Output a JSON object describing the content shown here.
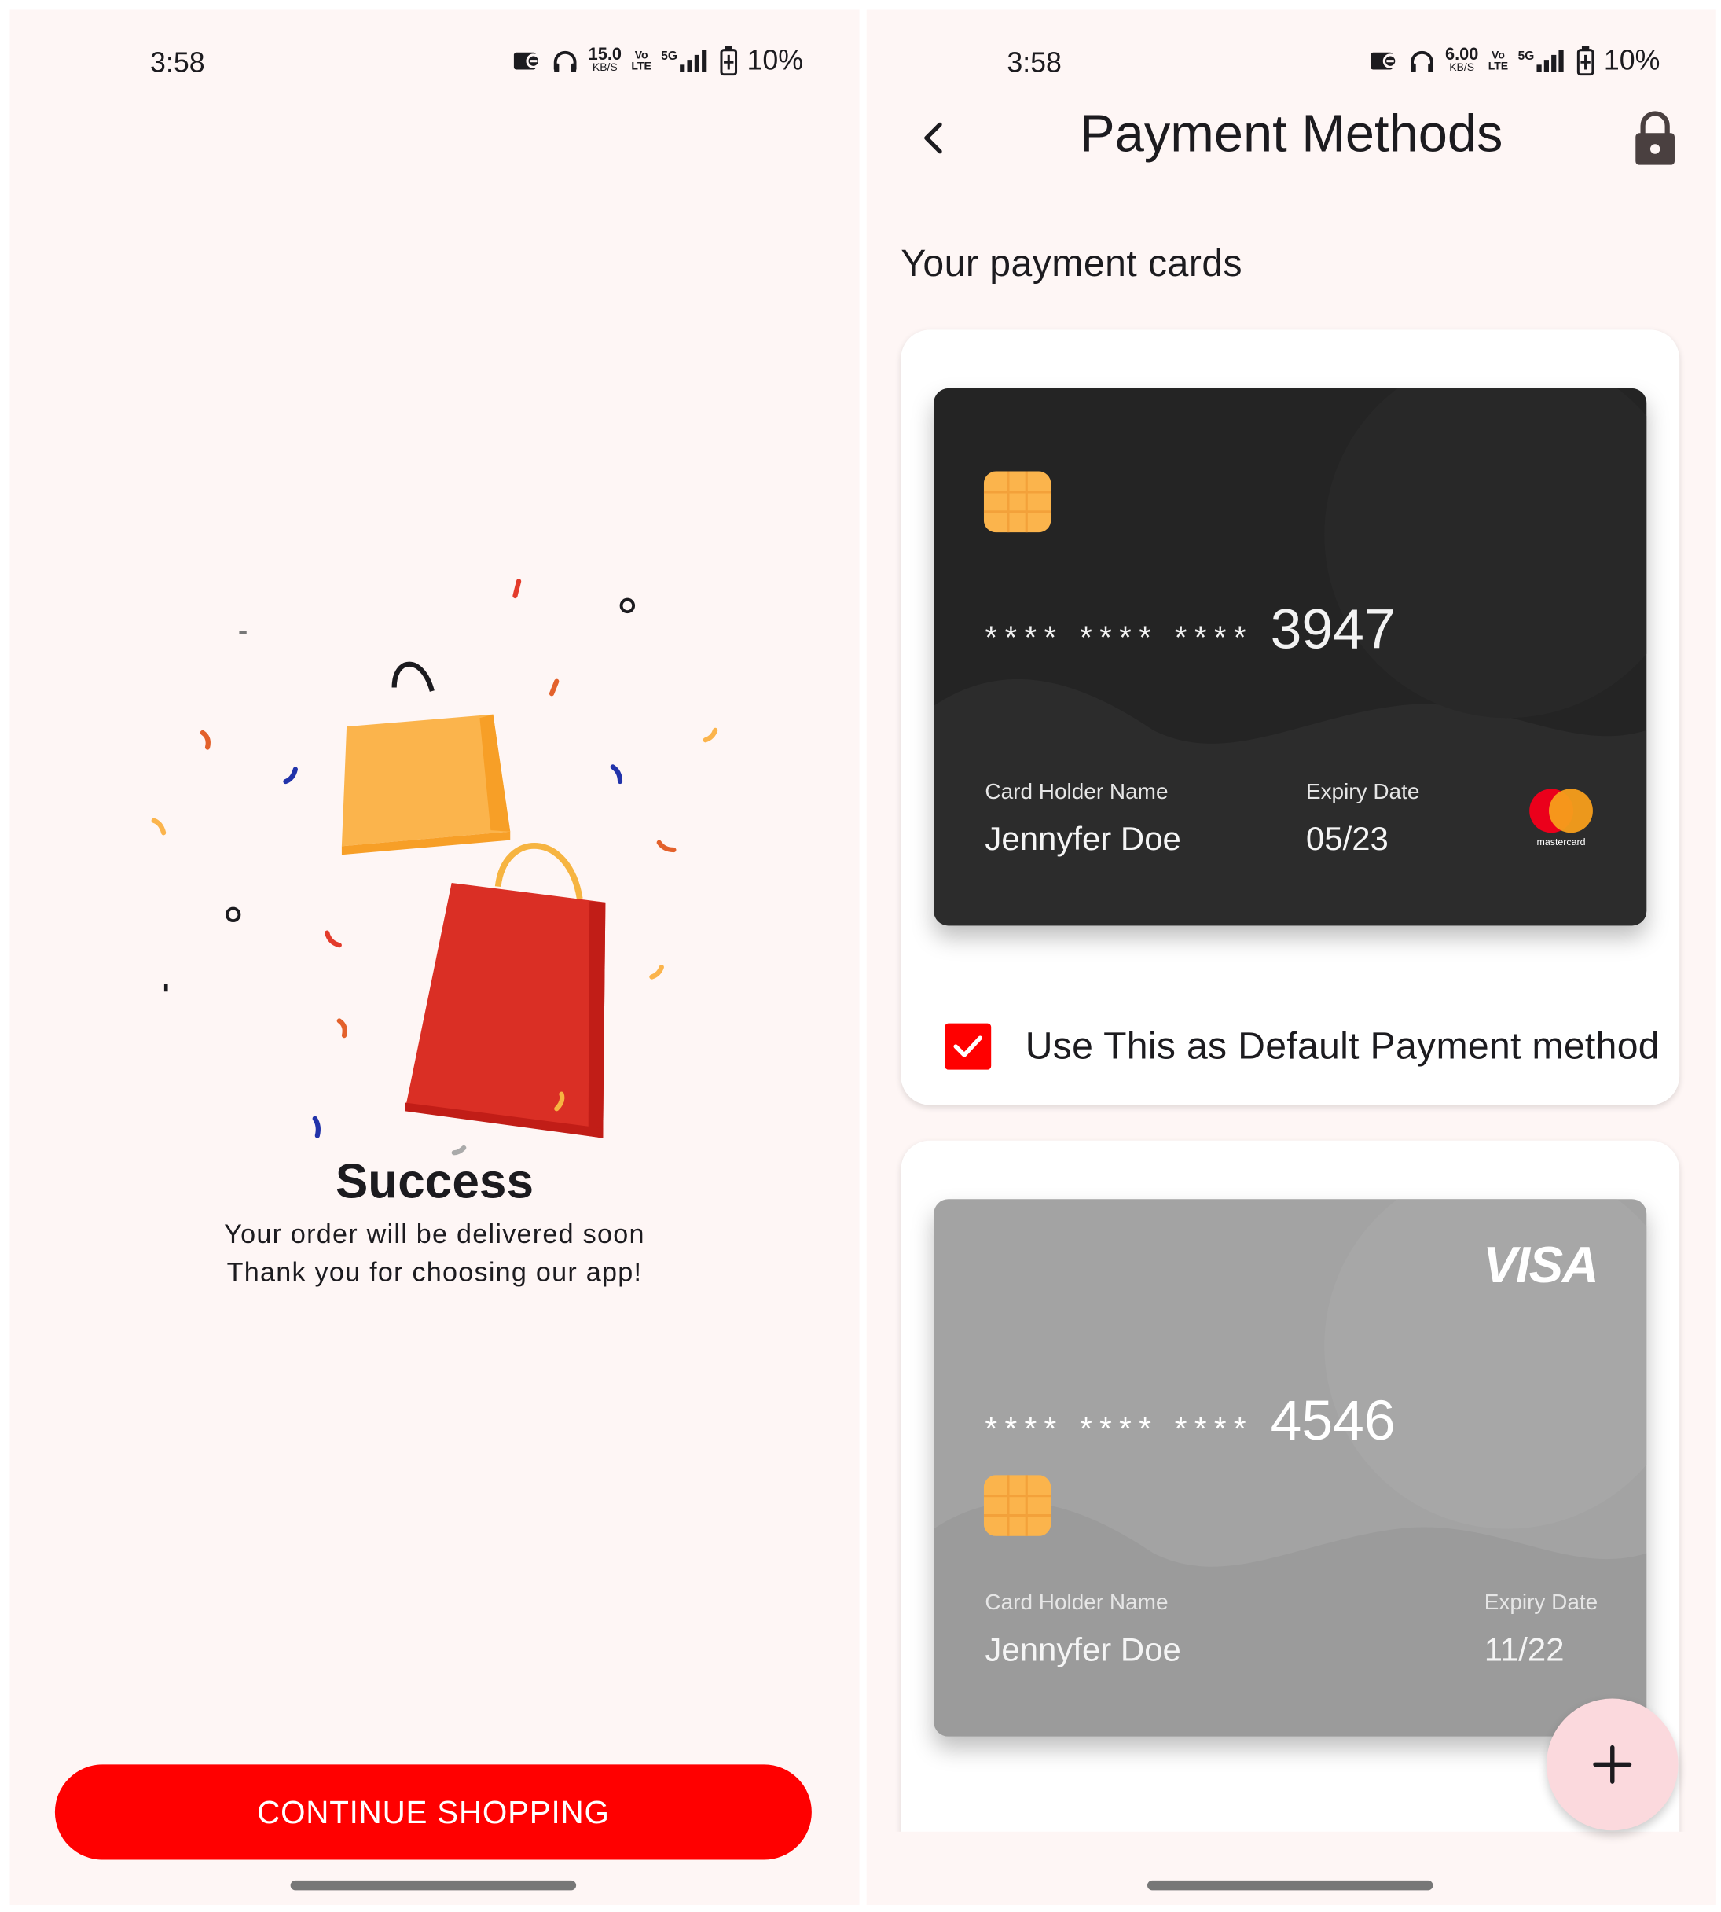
{
  "left_screen": {
    "status_bar": {
      "time": "3:58",
      "net_speed_value": "15.0",
      "net_speed_unit": "KB/S",
      "volte_top": "Vo",
      "volte_bottom": "LTE",
      "network": "5G",
      "battery": "10%"
    },
    "success_title": "Success",
    "message_line_1": "Your order will be delivered soon",
    "message_line_2": "Thank you for choosing our app!",
    "continue_button_label": "CONTINUE SHOPPING"
  },
  "right_screen": {
    "status_bar": {
      "time": "3:58",
      "net_speed_value": "6.00",
      "net_speed_unit": "KB/S",
      "volte_top": "Vo",
      "volte_bottom": "LTE",
      "network": "5G",
      "battery": "10%"
    },
    "title": "Payment Methods",
    "section_title": "Your payment cards",
    "cards": [
      {
        "brand": "mastercard",
        "brand_text": "mastercard",
        "mask": "**** **** ****",
        "last4": "3947",
        "holder_label": "Card Holder Name",
        "holder_name": "Jennyfer Doe",
        "expiry_label": "Expiry Date",
        "expiry": "05/23",
        "default_label": "Use This as Default Payment method",
        "is_default": true
      },
      {
        "brand": "visa",
        "brand_text": "VISA",
        "mask": "**** **** ****",
        "last4": "4546",
        "holder_label": "Card Holder Name",
        "holder_name": "Jennyfer Doe",
        "expiry_label": "Expiry Date",
        "expiry": "11/22"
      }
    ],
    "fab_icon": "plus-icon"
  },
  "colors": {
    "background": "#fef6f5",
    "accent_red": "#ff0000",
    "card_dark": "#242424",
    "card_grey": "#a3a3a3",
    "chip": "#fbb44c",
    "fab": "#fbd9dd"
  }
}
